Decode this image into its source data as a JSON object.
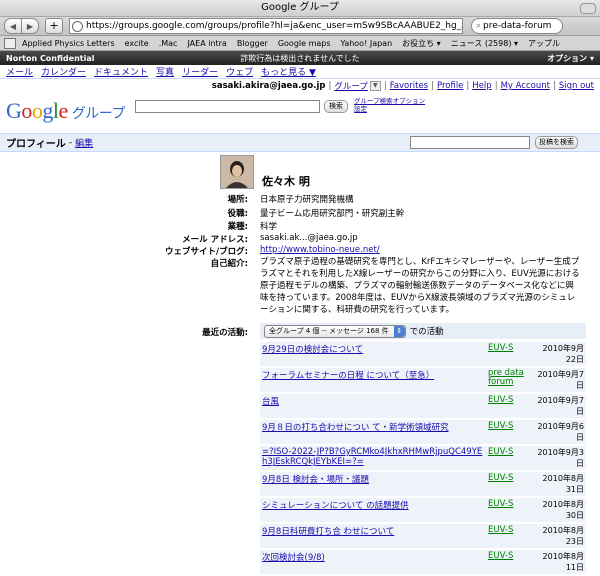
{
  "window": {
    "title": "Google グループ"
  },
  "browser": {
    "url": "https://groups.google.com/groups/profile?hl=ja&enc_user=mSw9SBcAAABUE2_hg_zS5D7twle0k0n_zR8",
    "search_text": "pre-data-forum",
    "bookmarks": [
      "Applied Physics Letters",
      "excite",
      ".Mac",
      "JAEA intra",
      "Blogger",
      "Google maps",
      "Yahoo! Japan",
      "お役立ち ▾",
      "ニュース (2598) ▾",
      "アップル"
    ]
  },
  "norton": {
    "left": "Norton Confidential",
    "center": "詐欺行為は検出されませんでした",
    "right": "オプション ▾"
  },
  "gbar": {
    "items": [
      "メール",
      "カレンダー",
      "ドキュメント",
      "写真",
      "リーダー",
      "ウェブ",
      "もっと見る ▼"
    ]
  },
  "userbar": {
    "email": "sasaki.akira@jaea.go.jp",
    "groups": "グループ",
    "links": [
      "Favorites",
      "Profile",
      "Help",
      "My Account",
      "Sign out"
    ]
  },
  "logo": {
    "subtitle": "グループ"
  },
  "search": {
    "button": "検索",
    "options": "グループ検索オプション\n設定"
  },
  "profile": {
    "title": "プロフィール",
    "edit": "編集",
    "post_search_button": "投稿を検索",
    "name": "佐々木 明",
    "fields": [
      {
        "label": "場所:",
        "value": "日本原子力研究開発機構"
      },
      {
        "label": "役職:",
        "value": "量子ビーム応用研究部門・研究副主幹"
      },
      {
        "label": "業種:",
        "value": "科学"
      },
      {
        "label": "メール アドレス:",
        "value": "sasaki.ak...@jaea.go.jp"
      },
      {
        "label": "ウェブサイト/ブログ:",
        "value": "http://www.tobino-neue.net/"
      }
    ],
    "intro_label": "自己紹介:",
    "intro": "プラズマ原子過程の基礎研究を専門とし、KrFエキシマレーザーや、レーザー生成プラズマとそれを利用したX線レーザーの研究からこの分野に入り、EUV光源における原子過程モデルの構築、プラズマの輻射輸送係数データのデータベース化などに興味を持っています。2008年度は、EUVからX線波長領域のプラズマ光源のシミュレーションに関する、科研費の研究を行っています。",
    "activity_label": "最近の活動:",
    "activity_select": "全グループ 4 個 -- メッセージ 168 件",
    "activity_suffix": "での活動",
    "activities": [
      {
        "title": "9月29日の検討会について",
        "group": "EUV-S",
        "date": "2010年9月22日"
      },
      {
        "title": "フォーラムセミナーの日程 について（至急）",
        "group": "pre data forum",
        "date": "2010年9月7日"
      },
      {
        "title": "台風",
        "group": "EUV-S",
        "date": "2010年9月7日"
      },
      {
        "title": "9月８日の打ち合わせについ て・新学術領域研究",
        "group": "EUV-S",
        "date": "2010年9月6日"
      },
      {
        "title": "=?ISO-2022-JP?B?GyRCMko4JkhxRHMwRjpuQC49YEh3JEskRCQkJEYbKEI=?=",
        "group": "EUV-S",
        "date": "2010年9月3日"
      },
      {
        "title": "9月8日 検討会・場所・議題",
        "group": "EUV-S",
        "date": "2010年8月31日"
      },
      {
        "title": "シミュレーションについて の話題提供",
        "group": "EUV-S",
        "date": "2010年8月30日"
      },
      {
        "title": "9月8日科研費打ち合 わせについて",
        "group": "EUV-S",
        "date": "2010年8月23日"
      },
      {
        "title": "次回検討会(9/8)",
        "group": "EUV-S",
        "date": "2010年8月11日"
      }
    ]
  },
  "colors": {
    "link": "#1a0dab",
    "group_link": "#008000",
    "header_bg": "#e8eef7"
  }
}
